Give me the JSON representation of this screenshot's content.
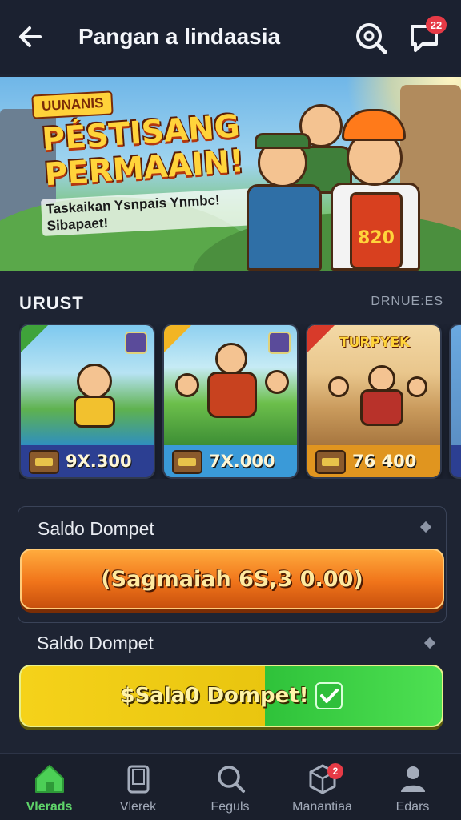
{
  "header": {
    "title": "Pangan a lindaasia",
    "notification_count": "22"
  },
  "banner": {
    "chip": "UUNANIS",
    "headline": "PÉSTISANG PERMAAIN!",
    "subtitle": "Taskaikan Ysnpais Ynmbc! Sibapaet!",
    "apron_text": "820"
  },
  "section": {
    "title": "URUST",
    "more_label": "DRNUE:ES"
  },
  "games": [
    {
      "price": "9X.300"
    },
    {
      "price": "7X.000"
    },
    {
      "price": "76 400",
      "card_title": "TURPYEK"
    }
  ],
  "wallet": {
    "label1": "Saldo Dompet",
    "button1": "(Sagmaiah 6S,3 0.00)",
    "label2": "Saldo Dompet",
    "button2": "$Sala0 Dompet!"
  },
  "nav": {
    "items": [
      {
        "label": "Vlerads",
        "icon": "home-icon"
      },
      {
        "label": "Vlerek",
        "icon": "wallet-icon"
      },
      {
        "label": "Feguls",
        "icon": "search-icon"
      },
      {
        "label": "Manantiaa",
        "icon": "box-icon",
        "badge": "2"
      },
      {
        "label": "Edars",
        "icon": "user-icon"
      }
    ]
  },
  "colors": {
    "background": "#1e2433",
    "accent_green": "#5fd36a",
    "accent_orange": "#f0741a",
    "badge_red": "#e63a46"
  }
}
